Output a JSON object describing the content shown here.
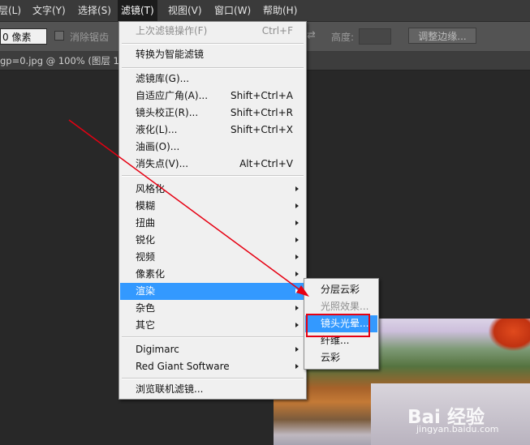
{
  "menubar": {
    "items": [
      {
        "label": "层(L)"
      },
      {
        "label": "文字(Y)"
      },
      {
        "label": "选择(S)"
      },
      {
        "label": "滤镜(T)"
      },
      {
        "label": "视图(V)"
      },
      {
        "label": "窗口(W)"
      },
      {
        "label": "帮助(H)"
      }
    ]
  },
  "options": {
    "feather_value": "0 像素",
    "antialias_label": "消除锯齿",
    "swap_symbol": "⇄",
    "height_label": "高度:",
    "height_value": "",
    "refine_edge_label": "调整边缘..."
  },
  "document": {
    "tab_title": "gp=0.jpg @ 100% (图层 1, R("
  },
  "filter_menu": {
    "items": [
      {
        "label": "上次滤镜操作(F)",
        "shortcut": "Ctrl+F",
        "disabled": true
      },
      {
        "label": "转换为智能滤镜"
      },
      {
        "label": "滤镜库(G)..."
      },
      {
        "label": "自适应广角(A)...",
        "shortcut": "Shift+Ctrl+A"
      },
      {
        "label": "镜头校正(R)...",
        "shortcut": "Shift+Ctrl+R"
      },
      {
        "label": "液化(L)...",
        "shortcut": "Shift+Ctrl+X"
      },
      {
        "label": "油画(O)..."
      },
      {
        "label": "消失点(V)...",
        "shortcut": "Alt+Ctrl+V"
      },
      {
        "label": "风格化"
      },
      {
        "label": "模糊"
      },
      {
        "label": "扭曲"
      },
      {
        "label": "锐化"
      },
      {
        "label": "视频"
      },
      {
        "label": "像素化"
      },
      {
        "label": "渲染",
        "highlighted": true
      },
      {
        "label": "杂色"
      },
      {
        "label": "其它"
      },
      {
        "label": "Digimarc"
      },
      {
        "label": "Red Giant Software"
      },
      {
        "label": "浏览联机滤镜..."
      }
    ]
  },
  "render_submenu": {
    "items": [
      {
        "label": "分层云彩"
      },
      {
        "label": "光照效果...",
        "disabled": true
      },
      {
        "label": "镜头光晕...",
        "highlighted": true
      },
      {
        "label": "纤维..."
      },
      {
        "label": "云彩"
      }
    ]
  },
  "watermark": {
    "brand": "Bai 经验",
    "url": "jingyan.baidu.com"
  },
  "colors": {
    "highlight": "#3399ff",
    "annotation_red": "#e60012"
  }
}
